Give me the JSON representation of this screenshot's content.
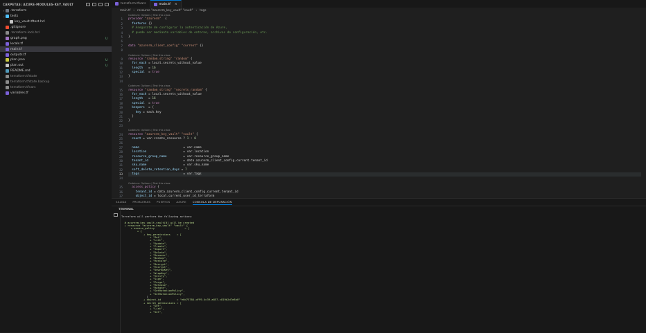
{
  "sidebar": {
    "title": "CARPETAS: AZURE-MODULES-KEY_VAULT",
    "items": [
      {
        "label": ".terraform",
        "kind": "folder",
        "collapsed": true,
        "indent": 0,
        "icon_color": "#6e7681",
        "badge": "",
        "dim": false,
        "selected": false
      },
      {
        "label": "tests",
        "kind": "folder",
        "collapsed": false,
        "indent": 0,
        "icon_color": "#4fc1ff",
        "badge": "",
        "dim": false,
        "selected": false
      },
      {
        "label": "key_vault.tftest.hcl",
        "kind": "file",
        "indent": 1,
        "icon_color": "#c5c5c5",
        "badge": "",
        "dim": false,
        "selected": false
      },
      {
        "label": ".gitignore",
        "kind": "file",
        "indent": 0,
        "icon_color": "#f14e32",
        "badge": "",
        "dim": false,
        "selected": false
      },
      {
        "label": ".terraform.lock.hcl",
        "kind": "file",
        "indent": 0,
        "icon_color": "#8b8b8b",
        "badge": "",
        "dim": true,
        "selected": false
      },
      {
        "label": "graph.png",
        "kind": "file",
        "indent": 0,
        "icon_color": "#a074c4",
        "badge": "U",
        "dim": false,
        "selected": false
      },
      {
        "label": "locals.tf",
        "kind": "file",
        "indent": 0,
        "icon_color": "#7b61d9",
        "badge": "",
        "dim": false,
        "selected": false
      },
      {
        "label": "main.tf",
        "kind": "file",
        "indent": 0,
        "icon_color": "#7b61d9",
        "badge": "",
        "dim": false,
        "selected": true
      },
      {
        "label": "outputs.tf",
        "kind": "file",
        "indent": 0,
        "icon_color": "#7b61d9",
        "badge": "",
        "dim": false,
        "selected": false
      },
      {
        "label": "plan.json",
        "kind": "file",
        "indent": 0,
        "icon_color": "#cbcb41",
        "badge": "U",
        "dim": false,
        "selected": false
      },
      {
        "label": "plan.out",
        "kind": "file",
        "indent": 0,
        "icon_color": "#c5c5c5",
        "badge": "U",
        "dim": false,
        "selected": false
      },
      {
        "label": "README.md",
        "kind": "file",
        "indent": 0,
        "icon_color": "#519aba",
        "badge": "",
        "dim": false,
        "selected": false
      },
      {
        "label": "terraform.tfstate",
        "kind": "file",
        "indent": 0,
        "icon_color": "#8b8b8b",
        "badge": "",
        "dim": true,
        "selected": false
      },
      {
        "label": "terraform.tfstate.backup",
        "kind": "file",
        "indent": 0,
        "icon_color": "#8b8b8b",
        "badge": "",
        "dim": true,
        "selected": false
      },
      {
        "label": "terraform.tfvars",
        "kind": "file",
        "indent": 0,
        "icon_color": "#8b8b8b",
        "badge": "",
        "dim": true,
        "selected": false
      },
      {
        "label": "variables.tf",
        "kind": "file",
        "indent": 0,
        "icon_color": "#7b61d9",
        "badge": "",
        "dim": false,
        "selected": false
      }
    ]
  },
  "tabs": [
    {
      "label": "terraform.tfvars",
      "active": false
    },
    {
      "label": "main.tf",
      "active": true,
      "close": "×"
    }
  ],
  "breadcrumb": [
    "main.tf",
    "resource \"azurerm_key_vault\" \"vault\"",
    "tags"
  ],
  "editor": {
    "active_line": "33",
    "lines": [
      {
        "n": "",
        "lens": "Codeium: Options | Test this class"
      },
      {
        "n": "1",
        "segs": [
          [
            "kw",
            "provider "
          ],
          [
            "str",
            "\"azurerm\""
          ],
          [
            "",
            "  {"
          ]
        ]
      },
      {
        "n": "2",
        "segs": [
          [
            "vr",
            "  features "
          ],
          [
            "",
            "{}"
          ]
        ]
      },
      {
        "n": "3",
        "segs": [
          [
            "cm",
            "  # Asegúrate de configurar la autenticación de Azure,"
          ]
        ]
      },
      {
        "n": "4",
        "segs": [
          [
            "cm",
            "  # puede ser mediante variables de entorno, archivos de configuración, etc."
          ]
        ]
      },
      {
        "n": "5",
        "segs": [
          [
            "",
            "}"
          ]
        ]
      },
      {
        "n": "6",
        "segs": [
          [
            "",
            ""
          ]
        ]
      },
      {
        "n": "7",
        "segs": [
          [
            "kw",
            "data "
          ],
          [
            "str",
            "\"azurerm_client_config\" \"current\""
          ],
          [
            "",
            " {}"
          ]
        ]
      },
      {
        "n": "8",
        "segs": [
          [
            "",
            ""
          ]
        ]
      },
      {
        "n": "",
        "lens": "Codeium: Options | Test this class"
      },
      {
        "n": "9",
        "segs": [
          [
            "kw",
            "resource "
          ],
          [
            "str",
            "\"random_string\" \"random\""
          ],
          [
            "",
            " {"
          ]
        ]
      },
      {
        "n": "10",
        "segs": [
          [
            "vr",
            "  for_each "
          ],
          [
            "",
            "= local.secrets_without_value"
          ]
        ]
      },
      {
        "n": "11",
        "segs": [
          [
            "vr",
            "  length "
          ],
          [
            "",
            "  = "
          ],
          [
            "num",
            "16"
          ]
        ]
      },
      {
        "n": "12",
        "segs": [
          [
            "vr",
            "  special "
          ],
          [
            "",
            " = "
          ],
          [
            "kw",
            "true"
          ]
        ]
      },
      {
        "n": "13",
        "segs": [
          [
            "",
            "}"
          ]
        ]
      },
      {
        "n": "14",
        "segs": [
          [
            "",
            ""
          ]
        ]
      },
      {
        "n": "",
        "lens": "Codeium: Options | Test this class"
      },
      {
        "n": "15",
        "segs": [
          [
            "kw",
            "resource "
          ],
          [
            "str",
            "\"random_string\" \"secrets_random\""
          ],
          [
            "",
            " {"
          ]
        ]
      },
      {
        "n": "16",
        "segs": [
          [
            "vr",
            "  for_each "
          ],
          [
            "",
            "= local.secrets_without_value"
          ]
        ]
      },
      {
        "n": "17",
        "segs": [
          [
            "vr",
            "  length "
          ],
          [
            "",
            "  = "
          ],
          [
            "num",
            "16"
          ]
        ]
      },
      {
        "n": "18",
        "segs": [
          [
            "vr",
            "  special "
          ],
          [
            "",
            " = "
          ],
          [
            "kw",
            "true"
          ]
        ]
      },
      {
        "n": "19",
        "segs": [
          [
            "vr",
            "  keepers "
          ],
          [
            "",
            " = {"
          ]
        ]
      },
      {
        "n": "20",
        "segs": [
          [
            "vr",
            "    key "
          ],
          [
            "",
            "= each.key"
          ]
        ]
      },
      {
        "n": "21",
        "segs": [
          [
            "",
            "  }"
          ]
        ]
      },
      {
        "n": "22",
        "segs": [
          [
            "",
            "}"
          ]
        ]
      },
      {
        "n": "23",
        "segs": [
          [
            "",
            ""
          ]
        ]
      },
      {
        "n": "",
        "lens": "Codeium: Options | Test this class"
      },
      {
        "n": "24",
        "segs": [
          [
            "kw",
            "resource "
          ],
          [
            "str",
            "\"azurerm_key_vault\" \"vault\""
          ],
          [
            "",
            " {"
          ]
        ]
      },
      {
        "n": "25",
        "segs": [
          [
            "vr",
            "  count "
          ],
          [
            "",
            "= var.create_resource ? "
          ],
          [
            "num",
            "1"
          ],
          [
            "",
            " : "
          ],
          [
            "num",
            "0"
          ]
        ]
      },
      {
        "n": "26",
        "segs": [
          [
            "",
            ""
          ]
        ]
      },
      {
        "n": "27",
        "segs": [
          [
            "vr",
            "  name"
          ],
          [
            "",
            "                        = var.name"
          ]
        ]
      },
      {
        "n": "28",
        "segs": [
          [
            "vr",
            "  location"
          ],
          [
            "",
            "                    = var.location"
          ]
        ]
      },
      {
        "n": "29",
        "segs": [
          [
            "vr",
            "  resource_group_name"
          ],
          [
            "",
            "         = var.resource_group_name"
          ]
        ]
      },
      {
        "n": "30",
        "segs": [
          [
            "vr",
            "  tenant_id"
          ],
          [
            "",
            "                   = data.azurerm_client_config.current.tenant_id"
          ]
        ]
      },
      {
        "n": "31",
        "segs": [
          [
            "vr",
            "  sku_name"
          ],
          [
            "",
            "                    = var.sku_name"
          ]
        ]
      },
      {
        "n": "32",
        "segs": [
          [
            "vr",
            "  soft_delete_retention_days"
          ],
          [
            "",
            " = "
          ],
          [
            "num",
            "7"
          ]
        ]
      },
      {
        "n": "33",
        "segs": [
          [
            "vr",
            "  tags"
          ],
          [
            "",
            "                        = var.tags"
          ]
        ],
        "hl": true
      },
      {
        "n": "34",
        "segs": [
          [
            "",
            ""
          ]
        ]
      },
      {
        "n": "",
        "lens": "Codeium: Options | Test this class"
      },
      {
        "n": "35",
        "segs": [
          [
            "kw",
            "  access_policy"
          ],
          [
            "",
            " {"
          ]
        ]
      },
      {
        "n": "36",
        "segs": [
          [
            "vr",
            "    tenant_id "
          ],
          [
            "",
            "= data.azurerm_client_config.current.tenant_id"
          ]
        ]
      },
      {
        "n": "37",
        "segs": [
          [
            "vr",
            "    object_id "
          ],
          [
            "",
            "= local.current_user_id_terraform"
          ]
        ]
      }
    ]
  },
  "panel": {
    "tabs": [
      {
        "label": "SALIDA",
        "active": false
      },
      {
        "label": "PROBLEMAS",
        "active": false
      },
      {
        "label": "PUERTOS",
        "active": false
      },
      {
        "label": "AZURE",
        "active": false
      },
      {
        "label": "CONSOLA DE DEPURACIÓN",
        "active": true
      }
    ],
    "terminal_title": "TERMINAL",
    "terminal_lines": [
      "Terraform will perform the following actions:",
      "",
      "  # azurerm_key_vault.vault[0] will be created",
      "  + resource \"azurerm_key_vault\" \"vault\" {",
      "      + access_policy                   = [",
      "          + {",
      "              + key_permissions    = [",
      "                  + \"Get\",",
      "                  + \"List\",",
      "                  + \"Update\",",
      "                  + \"Create\",",
      "                  + \"Import\",",
      "                  + \"Delete\",",
      "                  + \"Recover\",",
      "                  + \"Backup\",",
      "                  + \"Restore\",",
      "                  + \"Decrypt\",",
      "                  + \"Encrypt\",",
      "                  + \"UnwrapKey\",",
      "                  + \"WrapKey\",",
      "                  + \"Verify\",",
      "                  + \"Sign\",",
      "                  + \"Purge\",",
      "                  + \"Release\",",
      "                  + \"Rotate\",",
      "                  + \"GetRotationPolicy\",",
      "                  + \"SetRotationPolicy\",",
      "                ]",
      "              + object_id          = \"e6d75784-df99-4c39-a857-c819b2d7e8b0\"",
      "              + secret_permissions = [",
      "                  + \"Get\",",
      "                  + \"List\",",
      "                  + \"Set\","
    ]
  }
}
